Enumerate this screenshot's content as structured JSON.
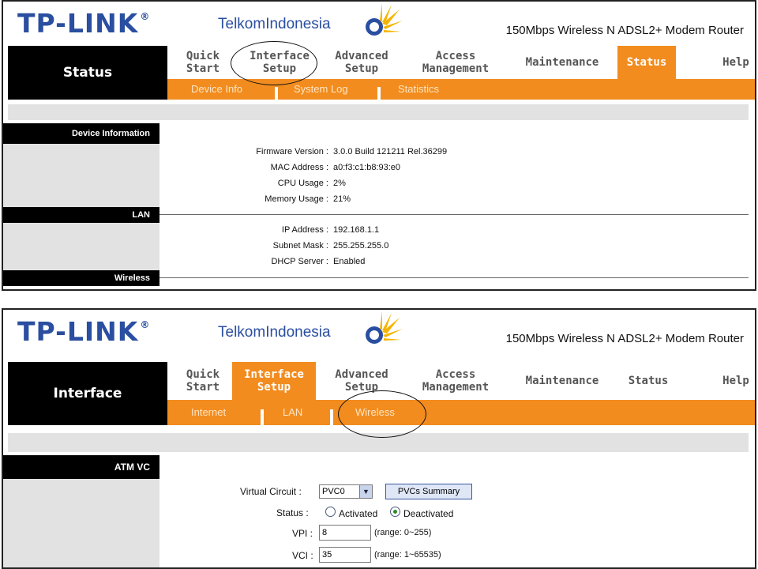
{
  "top": {
    "brand": "TP-LINK",
    "brand_mark": "®",
    "partner_a": "Telkom",
    "partner_b": "Indonesia",
    "product": "150Mbps Wireless N ADSL2+ Modem Router",
    "section_title": "Status",
    "tabs": [
      {
        "l1": "Quick",
        "l2": "Start"
      },
      {
        "l1": "Interface",
        "l2": "Setup"
      },
      {
        "l1": "Advanced",
        "l2": "Setup"
      },
      {
        "l1": "Access",
        "l2": "Management"
      },
      {
        "l1": "Maintenance",
        "l2": ""
      },
      {
        "l1": "Status",
        "l2": ""
      },
      {
        "l1": "Help",
        "l2": ""
      }
    ],
    "subtabs": [
      "Device Info",
      "System Log",
      "Statistics"
    ],
    "sections": {
      "device": "Device Information",
      "lan": "LAN",
      "wireless": "Wireless"
    },
    "device_rows": [
      {
        "label": "Firmware Version :",
        "value": "3.0.0 Build 121211 Rel.36299"
      },
      {
        "label": "MAC Address :",
        "value": "a0:f3:c1:b8:93:e0"
      },
      {
        "label": "CPU Usage :",
        "value": "2%"
      },
      {
        "label": "Memory Usage :",
        "value": "21%"
      }
    ],
    "lan_rows": [
      {
        "label": "IP Address :",
        "value": "192.168.1.1"
      },
      {
        "label": "Subnet Mask :",
        "value": "255.255.255.0"
      },
      {
        "label": "DHCP Server :",
        "value": "Enabled"
      }
    ]
  },
  "bottom": {
    "brand": "TP-LINK",
    "brand_mark": "®",
    "partner_a": "Telkom",
    "partner_b": "Indonesia",
    "product": "150Mbps Wireless N ADSL2+ Modem Router",
    "section_title": "Interface",
    "tabs": [
      {
        "l1": "Quick",
        "l2": "Start"
      },
      {
        "l1": "Interface",
        "l2": "Setup"
      },
      {
        "l1": "Advanced",
        "l2": "Setup"
      },
      {
        "l1": "Access",
        "l2": "Management"
      },
      {
        "l1": "Maintenance",
        "l2": ""
      },
      {
        "l1": "Status",
        "l2": ""
      },
      {
        "l1": "Help",
        "l2": ""
      }
    ],
    "subtabs": [
      "Internet",
      "LAN",
      "Wireless"
    ],
    "section": "ATM VC",
    "virtual_circuit_label": "Virtual Circuit :",
    "virtual_circuit_value": "PVC0",
    "pvcs_summary_button": "PVCs Summary",
    "status_label": "Status :",
    "status_activated": "Activated",
    "status_deactivated": "Deactivated",
    "vpi_label": "VPI :",
    "vpi_value": "8",
    "vpi_range": "(range: 0~255)",
    "vci_label": "VCI :",
    "vci_value": "35",
    "vci_range": "(range: 1~65535)"
  },
  "colors": {
    "brand_blue": "#2a4ea0",
    "nav_orange": "#f28c1f",
    "nav_black": "#000000",
    "panel_gray": "#e2e2e2"
  }
}
